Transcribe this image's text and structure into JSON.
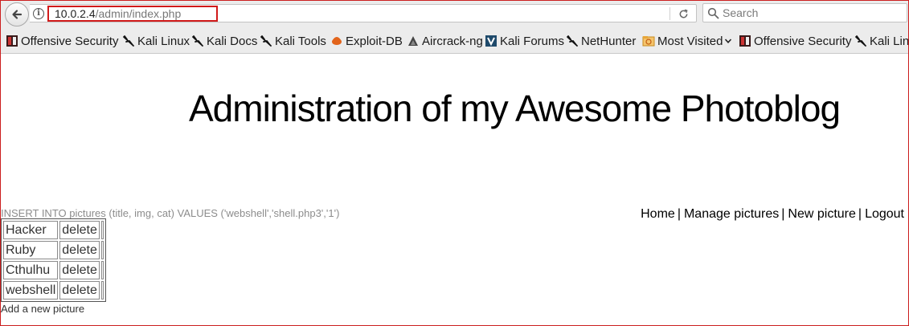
{
  "browser": {
    "url_host": "10.0.2.4",
    "url_path": "/admin/index.php",
    "search_placeholder": "Search"
  },
  "bookmarks": [
    {
      "label": "Offensive Security",
      "icon": "offsec-icon"
    },
    {
      "label": "Kali Linux",
      "icon": "kali-dragon-icon"
    },
    {
      "label": "Kali Docs",
      "icon": "kali-dragon-icon"
    },
    {
      "label": "Kali Tools",
      "icon": "kali-dragon-icon"
    },
    {
      "label": "Exploit-DB",
      "icon": "exploitdb-icon"
    },
    {
      "label": "Aircrack-ng",
      "icon": "aircrack-icon"
    },
    {
      "label": "Kali Forums",
      "icon": "kali-forums-icon"
    },
    {
      "label": "NetHunter",
      "icon": "kali-dragon-icon"
    },
    {
      "label": "Most Visited",
      "icon": "folder-icon"
    },
    {
      "label": "Offensive Security",
      "icon": "offsec-icon"
    },
    {
      "label": "Kali Linux",
      "icon": "kali-dragon-icon"
    }
  ],
  "page": {
    "title": "Administration of my Awesome Photoblog",
    "sql_debug": "INSERT INTO pictures (title, img, cat) VALUES ('webshell','shell.php3','1')",
    "nav": {
      "home": "Home",
      "manage": "Manage pictures",
      "new": "New picture",
      "logout": "Logout",
      "separator": "|"
    },
    "pictures": [
      {
        "title": "Hacker",
        "action": "delete"
      },
      {
        "title": "Ruby",
        "action": "delete"
      },
      {
        "title": "Cthulhu",
        "action": "delete"
      },
      {
        "title": "webshell",
        "action": "delete"
      }
    ],
    "add_link": "Add a new picture"
  },
  "colors": {
    "highlight_red": "#d11a1a",
    "chrome_bg": "#ececec"
  }
}
